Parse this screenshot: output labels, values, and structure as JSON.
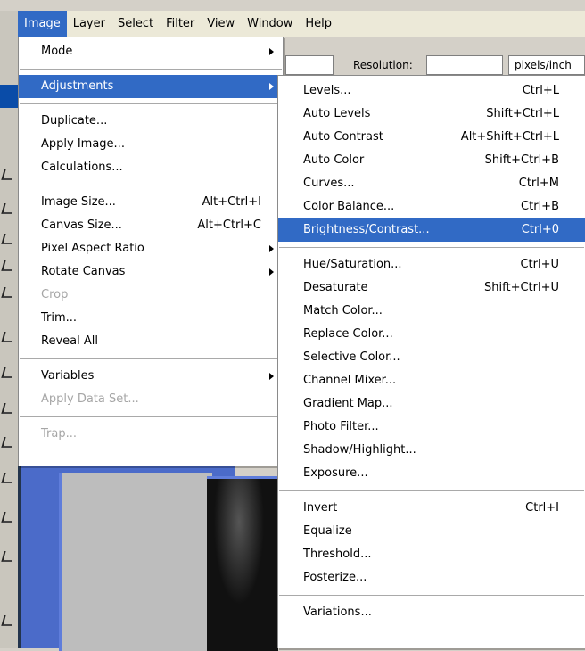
{
  "menubar": {
    "items": [
      "Image",
      "Layer",
      "Select",
      "Filter",
      "View",
      "Window",
      "Help"
    ],
    "active_index": 0
  },
  "options_bar": {
    "resolution_label": "Resolution:",
    "units": "pixels/inch"
  },
  "image_menu": {
    "groups": [
      [
        {
          "label": "Mode",
          "submenu": true
        }
      ],
      [
        {
          "label": "Adjustments",
          "submenu": true,
          "highlighted": true
        }
      ],
      [
        {
          "label": "Duplicate..."
        },
        {
          "label": "Apply Image..."
        },
        {
          "label": "Calculations..."
        }
      ],
      [
        {
          "label": "Image Size...",
          "shortcut": "Alt+Ctrl+I"
        },
        {
          "label": "Canvas Size...",
          "shortcut": "Alt+Ctrl+C"
        },
        {
          "label": "Pixel Aspect Ratio",
          "submenu": true
        },
        {
          "label": "Rotate Canvas",
          "submenu": true
        },
        {
          "label": "Crop",
          "disabled": true
        },
        {
          "label": "Trim..."
        },
        {
          "label": "Reveal All"
        }
      ],
      [
        {
          "label": "Variables",
          "submenu": true
        },
        {
          "label": "Apply Data Set...",
          "disabled": true
        }
      ],
      [
        {
          "label": "Trap...",
          "disabled": true
        }
      ]
    ]
  },
  "adjustments_menu": {
    "groups": [
      [
        {
          "label": "Levels...",
          "shortcut": "Ctrl+L"
        },
        {
          "label": "Auto Levels",
          "shortcut": "Shift+Ctrl+L"
        },
        {
          "label": "Auto Contrast",
          "shortcut": "Alt+Shift+Ctrl+L"
        },
        {
          "label": "Auto Color",
          "shortcut": "Shift+Ctrl+B"
        },
        {
          "label": "Curves...",
          "shortcut": "Ctrl+M"
        },
        {
          "label": "Color Balance...",
          "shortcut": "Ctrl+B"
        },
        {
          "label": "Brightness/Contrast...",
          "shortcut": "Ctrl+0",
          "highlighted": true
        }
      ],
      [
        {
          "label": "Hue/Saturation...",
          "shortcut": "Ctrl+U"
        },
        {
          "label": "Desaturate",
          "shortcut": "Shift+Ctrl+U"
        },
        {
          "label": "Match Color..."
        },
        {
          "label": "Replace Color..."
        },
        {
          "label": "Selective Color..."
        },
        {
          "label": "Channel Mixer..."
        },
        {
          "label": "Gradient Map..."
        },
        {
          "label": "Photo Filter..."
        },
        {
          "label": "Shadow/Highlight..."
        },
        {
          "label": "Exposure..."
        }
      ],
      [
        {
          "label": "Invert",
          "shortcut": "Ctrl+I"
        },
        {
          "label": "Equalize"
        },
        {
          "label": "Threshold..."
        },
        {
          "label": "Posterize..."
        }
      ],
      [
        {
          "label": "Variations..."
        }
      ]
    ]
  },
  "colors": {
    "highlight": "#316ac5",
    "menu_bg": "#ffffff",
    "menubar_bg": "#ece9d8",
    "disabled_text": "#a6a6a6"
  }
}
